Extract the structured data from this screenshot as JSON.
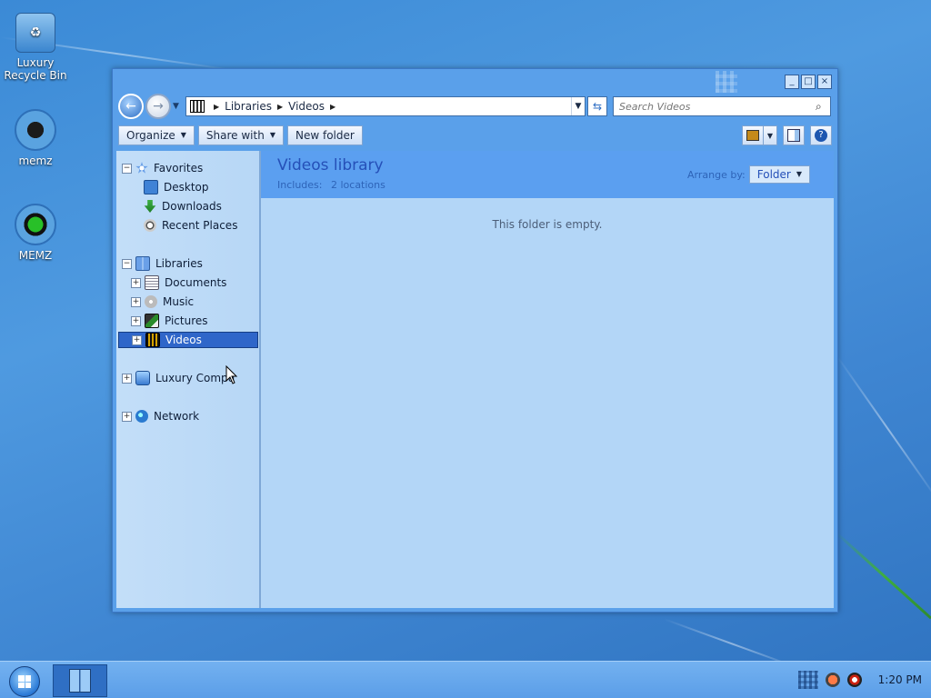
{
  "desktop": {
    "icons": [
      {
        "label": "Luxury\nRecycle Bin"
      },
      {
        "label": "memz"
      },
      {
        "label": "MEMZ"
      }
    ]
  },
  "window": {
    "controls": {
      "minimize": "_",
      "maximize": "□",
      "close": "×"
    },
    "address": {
      "crumbs": [
        "Libraries",
        "Videos"
      ]
    },
    "search": {
      "placeholder": "Search Videos"
    },
    "toolbar": {
      "organize": "Organize",
      "share_with": "Share with",
      "new_folder": "New folder"
    },
    "nav": {
      "favorites": "Favorites",
      "desktop": "Desktop",
      "downloads": "Downloads",
      "recent_places": "Recent Places",
      "libraries": "Libraries",
      "documents": "Documents",
      "music": "Music",
      "pictures": "Pictures",
      "videos": "Videos",
      "computer": "Luxury Compu",
      "network": "Network"
    },
    "library": {
      "title": "Videos library",
      "includes_label": "Includes:",
      "includes_value": "2 locations",
      "arrange_label": "Arrange by:",
      "arrange_value": "Folder",
      "empty_message": "This folder is empty."
    }
  },
  "taskbar": {
    "clock": "1:20 PM"
  },
  "colors": {
    "accent": "#2f66c9",
    "window_frame": "#5aa0ea",
    "content_bg": "#b3d6f7"
  }
}
